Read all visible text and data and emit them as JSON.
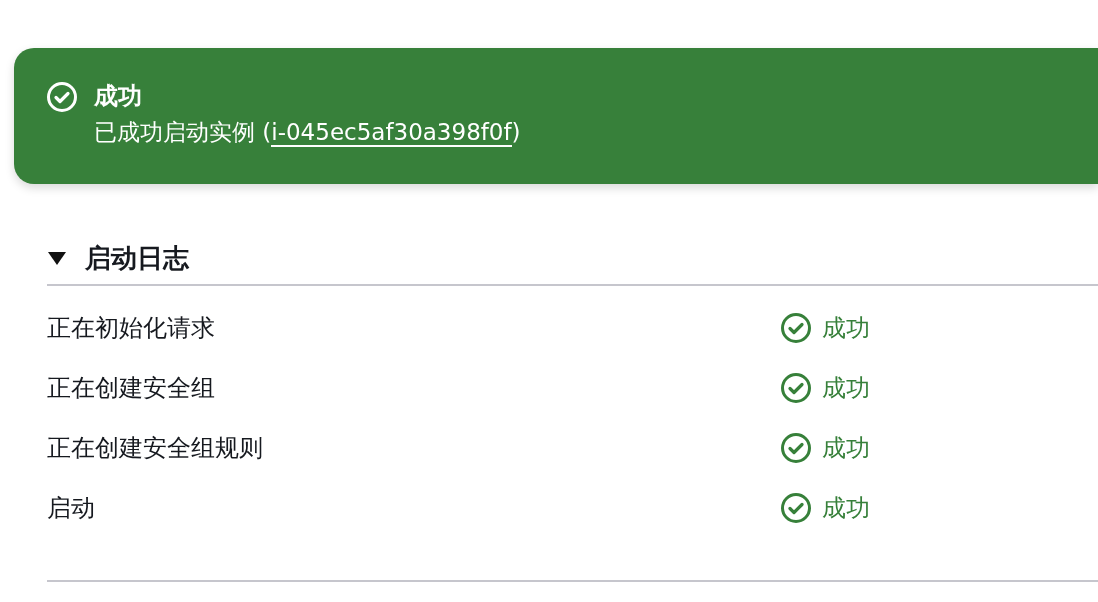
{
  "alert": {
    "kind": "success",
    "title": "成功",
    "message": "已成功启动实例 (",
    "instance_link": "i-045ec5af30a398f0f",
    "message_end": ")"
  },
  "launch_log": {
    "title": "启动日志",
    "expanded": true,
    "rows": [
      {
        "step": "正在初始化请求",
        "status": "成功",
        "kind": "success"
      },
      {
        "step": "正在创建安全组",
        "status": "成功",
        "kind": "success"
      },
      {
        "step": "正在创建安全组规则",
        "status": "成功",
        "kind": "success"
      },
      {
        "step": "启动",
        "status": "成功",
        "kind": "success"
      }
    ]
  }
}
